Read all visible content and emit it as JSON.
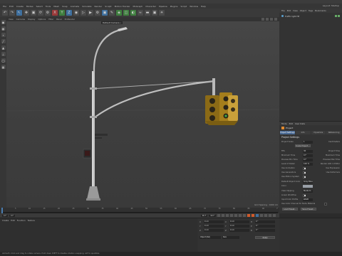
{
  "menubar": {
    "items": [
      "File",
      "Edit",
      "Create",
      "Modes",
      "Select",
      "Tools",
      "Mesh",
      "Snap",
      "Animate",
      "Simulate",
      "Render",
      "Sculpt",
      "Motion Tracker",
      "MoGraph",
      "Character",
      "Pipeline",
      "Plugins",
      "Script",
      "Window",
      "Help"
    ],
    "layout_label": "Layout: Startup"
  },
  "toolbar": {
    "icons": [
      "undo-icon",
      "redo-icon",
      "live-select-icon",
      "move-icon",
      "scale-icon",
      "rotate-icon",
      "recent-tools-icon",
      "x-axis-icon",
      "y-axis-icon",
      "z-axis-icon",
      "world-coords-icon",
      "render-view-icon",
      "render-picture-queue-icon",
      "render-settings-icon",
      "cube-icon",
      "pen-icon",
      "subdivision-icon",
      "array-icon",
      "boole-icon",
      "deformer-icon",
      "floor-icon",
      "camera-icon",
      "light-icon"
    ]
  },
  "viewport": {
    "menu": [
      "View",
      "Cameras",
      "Display",
      "Options",
      "Filter",
      "Panel",
      "ProRender"
    ],
    "camera_label": "Default Camera •",
    "status": "Grid Spacing : 1000 cm"
  },
  "object_manager": {
    "menu": [
      "File",
      "Edit",
      "View",
      "Object",
      "Tags",
      "Bookmarks"
    ],
    "object_name": "Traffic light HP"
  },
  "attributes": {
    "menu": [
      "Mode",
      "Edit",
      "User Data"
    ],
    "title": "Project",
    "tabs": [
      "Project Settings",
      "Info",
      "Dynamics",
      "Referencing"
    ],
    "active_tab": 0,
    "heading": "Project Settings",
    "rows": [
      {
        "label": "Project Scale",
        "value": "1",
        "right": "Centimeters"
      },
      {
        "label": "FPS",
        "value": "30",
        "right": "Project Time"
      },
      {
        "label": "Minimum Time",
        "value": "0 F",
        "right": "Maximum Time"
      },
      {
        "label": "Preview Min Time",
        "value": "0 F",
        "right": "Preview Max Time"
      },
      {
        "label": "Level of Detail",
        "value": "100 %",
        "right": "Render LOD in Editor"
      },
      {
        "label": "Use Animation",
        "check": true,
        "right": "Use Expression"
      },
      {
        "label": "Use Generators",
        "check": true,
        "right": "Use Deformers"
      },
      {
        "label": "Use Motion System",
        "check": true,
        "right": ""
      },
      {
        "label": "Default Object Color",
        "value": "Gray Blue",
        "right": ""
      },
      {
        "label": "Color",
        "value": "",
        "right": ""
      },
      {
        "label": "View Clipping",
        "value": "Medium",
        "right": ""
      },
      {
        "label": "Linear Workflow",
        "check": true,
        "right": ""
      },
      {
        "label": "Input Color Profile",
        "value": "sRGB",
        "right": ""
      },
      {
        "label": "Use Color Channel for Node Material",
        "check": false,
        "right": ""
      }
    ],
    "buttons": [
      "Load Preset...",
      "Save Preset..."
    ],
    "scale_button": "Scale Project..."
  },
  "timeline": {
    "ticks": [
      "0",
      "5",
      "10",
      "15",
      "20",
      "25",
      "30",
      "35",
      "40",
      "45",
      "50",
      "55",
      "60",
      "65",
      "70",
      "75",
      "80",
      "85",
      "90",
      "F"
    ],
    "current_frame_fraction": 0.0
  },
  "transport": {
    "start": "0 F",
    "current": "0 F",
    "end": "90 F",
    "max": "90 F"
  },
  "materials": {
    "menu": [
      "Create",
      "Edit",
      "Function",
      "Texture"
    ]
  },
  "coordinates": {
    "rows": [
      {
        "axis": "X",
        "pos": "0 cm",
        "axis2": "X",
        "size": "0 cm",
        "axis3": "H",
        "rot": "0 °"
      },
      {
        "axis": "Y",
        "pos": "0 cm",
        "axis2": "Y",
        "size": "0 cm",
        "axis3": "P",
        "rot": "0 °"
      },
      {
        "axis": "Z",
        "pos": "0 cm",
        "axis2": "Z",
        "size": "0 cm",
        "axis3": "B",
        "rot": "0 °"
      }
    ],
    "mode": "Object (Rel)",
    "size_mode": "Size",
    "apply": "Apply"
  },
  "statusbar": {
    "text": "Azimuth: Click and drag to rotate camera. Hold down SHIFT to disable rotation snapping. ALT to quantize."
  }
}
